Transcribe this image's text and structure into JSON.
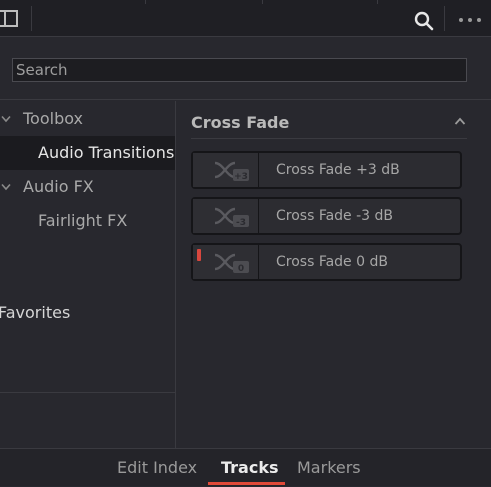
{
  "toolbar": {
    "panel_toggle_icon": "panel-toggle-icon",
    "search_icon": "search-icon",
    "more_icon": "more-options-icon"
  },
  "search": {
    "placeholder": "Search"
  },
  "sidebar": {
    "items": [
      {
        "label": "Toolbox",
        "expanded": true
      },
      {
        "label": "Audio Transitions",
        "selected": true
      },
      {
        "label": "Audio FX",
        "expanded": true
      },
      {
        "label": "Fairlight FX"
      }
    ],
    "favorites": "Favorites"
  },
  "content": {
    "section_title": "Cross Fade",
    "items": [
      {
        "label": "Cross Fade +3 dB",
        "badge": "+3",
        "marked": false
      },
      {
        "label": "Cross Fade -3 dB",
        "badge": "-3",
        "marked": false
      },
      {
        "label": "Cross Fade 0 dB",
        "badge": "0",
        "marked": true
      }
    ]
  },
  "bottom_tabs": [
    {
      "label": "Edit Index",
      "active": false
    },
    {
      "label": "Tracks",
      "active": true
    },
    {
      "label": "Markers",
      "active": false
    }
  ],
  "colors": {
    "accent": "#e04a38",
    "background": "#28282e",
    "topbar": "#1f1f24",
    "selected_row": "#1b1b1f"
  }
}
